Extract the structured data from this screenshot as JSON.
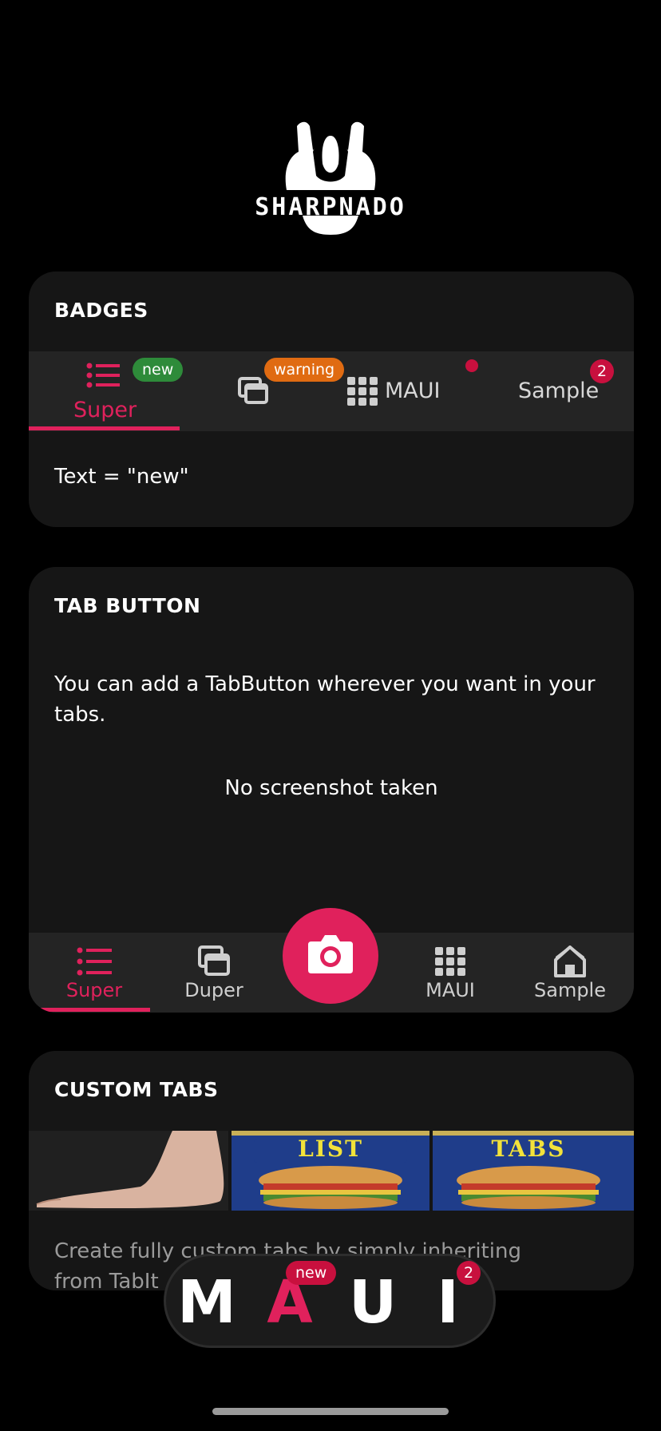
{
  "logo": {
    "text": "SHARPNADO"
  },
  "badges_card": {
    "title": "BADGES",
    "tabs": [
      {
        "label": "Super",
        "badge": "new",
        "selected": true,
        "icon": "list-icon"
      },
      {
        "label": "",
        "badge": "warning",
        "selected": false,
        "icon": "cards-icon"
      },
      {
        "label": "MAUI",
        "badge": "",
        "dot": true,
        "selected": false,
        "icon": "grid-icon"
      },
      {
        "label": "Sample",
        "badge": "2",
        "selected": false,
        "icon": ""
      }
    ],
    "body": "Text = \"new\""
  },
  "tab_button_card": {
    "title": "TAB BUTTON",
    "description": "You can add a TabButton wherever you want in your tabs.",
    "status": "No screenshot taken",
    "tabs": [
      {
        "label": "Super",
        "icon": "list-icon",
        "selected": true
      },
      {
        "label": "Duper",
        "icon": "cards-icon",
        "selected": false
      },
      {
        "label": "MAUI",
        "icon": "grid-icon",
        "selected": false
      },
      {
        "label": "Sample",
        "icon": "house-icon",
        "selected": false
      }
    ],
    "action_icon": "camera-icon"
  },
  "custom_tabs_card": {
    "title": "CUSTOM TABS",
    "images": [
      "foot-image",
      "spam-list-image",
      "spam-tabs-image"
    ],
    "image_texts": [
      "LIST",
      "TABS"
    ],
    "description_visible": "Create fully custom tabs by simply inheriting",
    "description_visible_line2": "from TabIt"
  },
  "maui_bar": {
    "letters": [
      "M",
      "A",
      "U",
      "I"
    ],
    "badge_a": "new",
    "badge_i": "2"
  },
  "colors": {
    "accent": "#e0215c",
    "badge_green": "#2e8b3a",
    "badge_orange": "#e06b12",
    "badge_red": "#c8103e",
    "card_bg": "#161616",
    "tabbar_bg": "#242424"
  }
}
